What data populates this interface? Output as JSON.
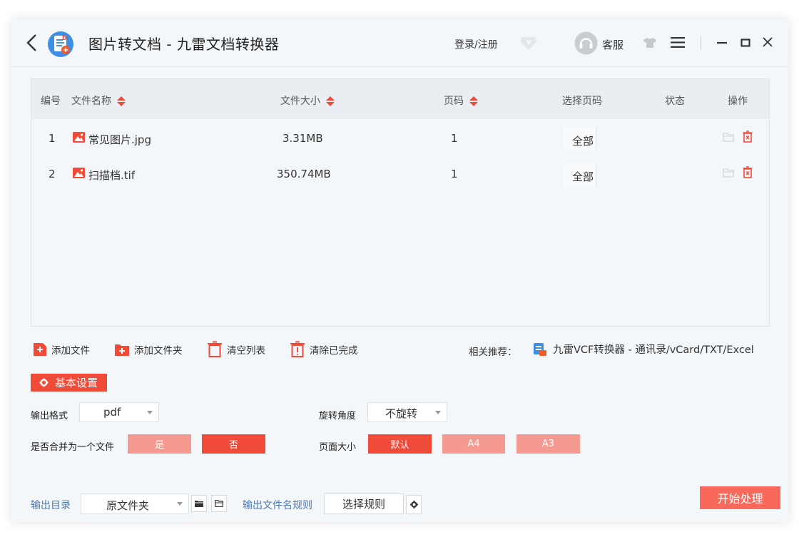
{
  "header": {
    "title": "图片转文档 - 九雷文档转换器",
    "login": "登录/注册",
    "service": "客服"
  },
  "table": {
    "columns": {
      "index": "编号",
      "name": "文件名称",
      "size": "文件大小",
      "pages": "页码",
      "select_pages": "选择页码",
      "status": "状态",
      "actions": "操作"
    },
    "rows": [
      {
        "index": "1",
        "name": "常见图片.jpg",
        "size": "3.31MB",
        "pages": "1",
        "select_pages": "全部",
        "status": ""
      },
      {
        "index": "2",
        "name": "扫描档.tif",
        "size": "350.74MB",
        "pages": "1",
        "select_pages": "全部",
        "status": ""
      }
    ]
  },
  "toolbar": {
    "add_file": "添加文件",
    "add_folder": "添加文件夹",
    "clear_list": "清空列表",
    "clear_done": "清除已完成",
    "recommend_label": "相关推荐：",
    "recommend_text": "九雷VCF转换器 - 通讯录/vCard/TXT/Excel"
  },
  "settings": {
    "tab": "基本设置",
    "format_label": "输出格式",
    "format_value": "pdf",
    "rotate_label": "旋转角度",
    "rotate_value": "不旋转",
    "merge_label": "是否合并为一个文件",
    "merge_yes": "是",
    "merge_no": "否",
    "merge_selected": "否",
    "page_size_label": "页面大小",
    "size_default": "默认",
    "size_a4": "A4",
    "size_a3": "A3",
    "size_selected": "默认"
  },
  "footer": {
    "out_dir_label": "输出目录",
    "out_dir_value": "原文件夹",
    "name_rule_label": "输出文件名规则",
    "name_rule_button": "选择规则",
    "start": "开始处理"
  },
  "colors": {
    "accent": "#f04a39",
    "accent_light": "#f59a90",
    "start_button": "#f9695b",
    "link_blue": "#4e7ab1",
    "window_bg": "#f4f7fa"
  }
}
